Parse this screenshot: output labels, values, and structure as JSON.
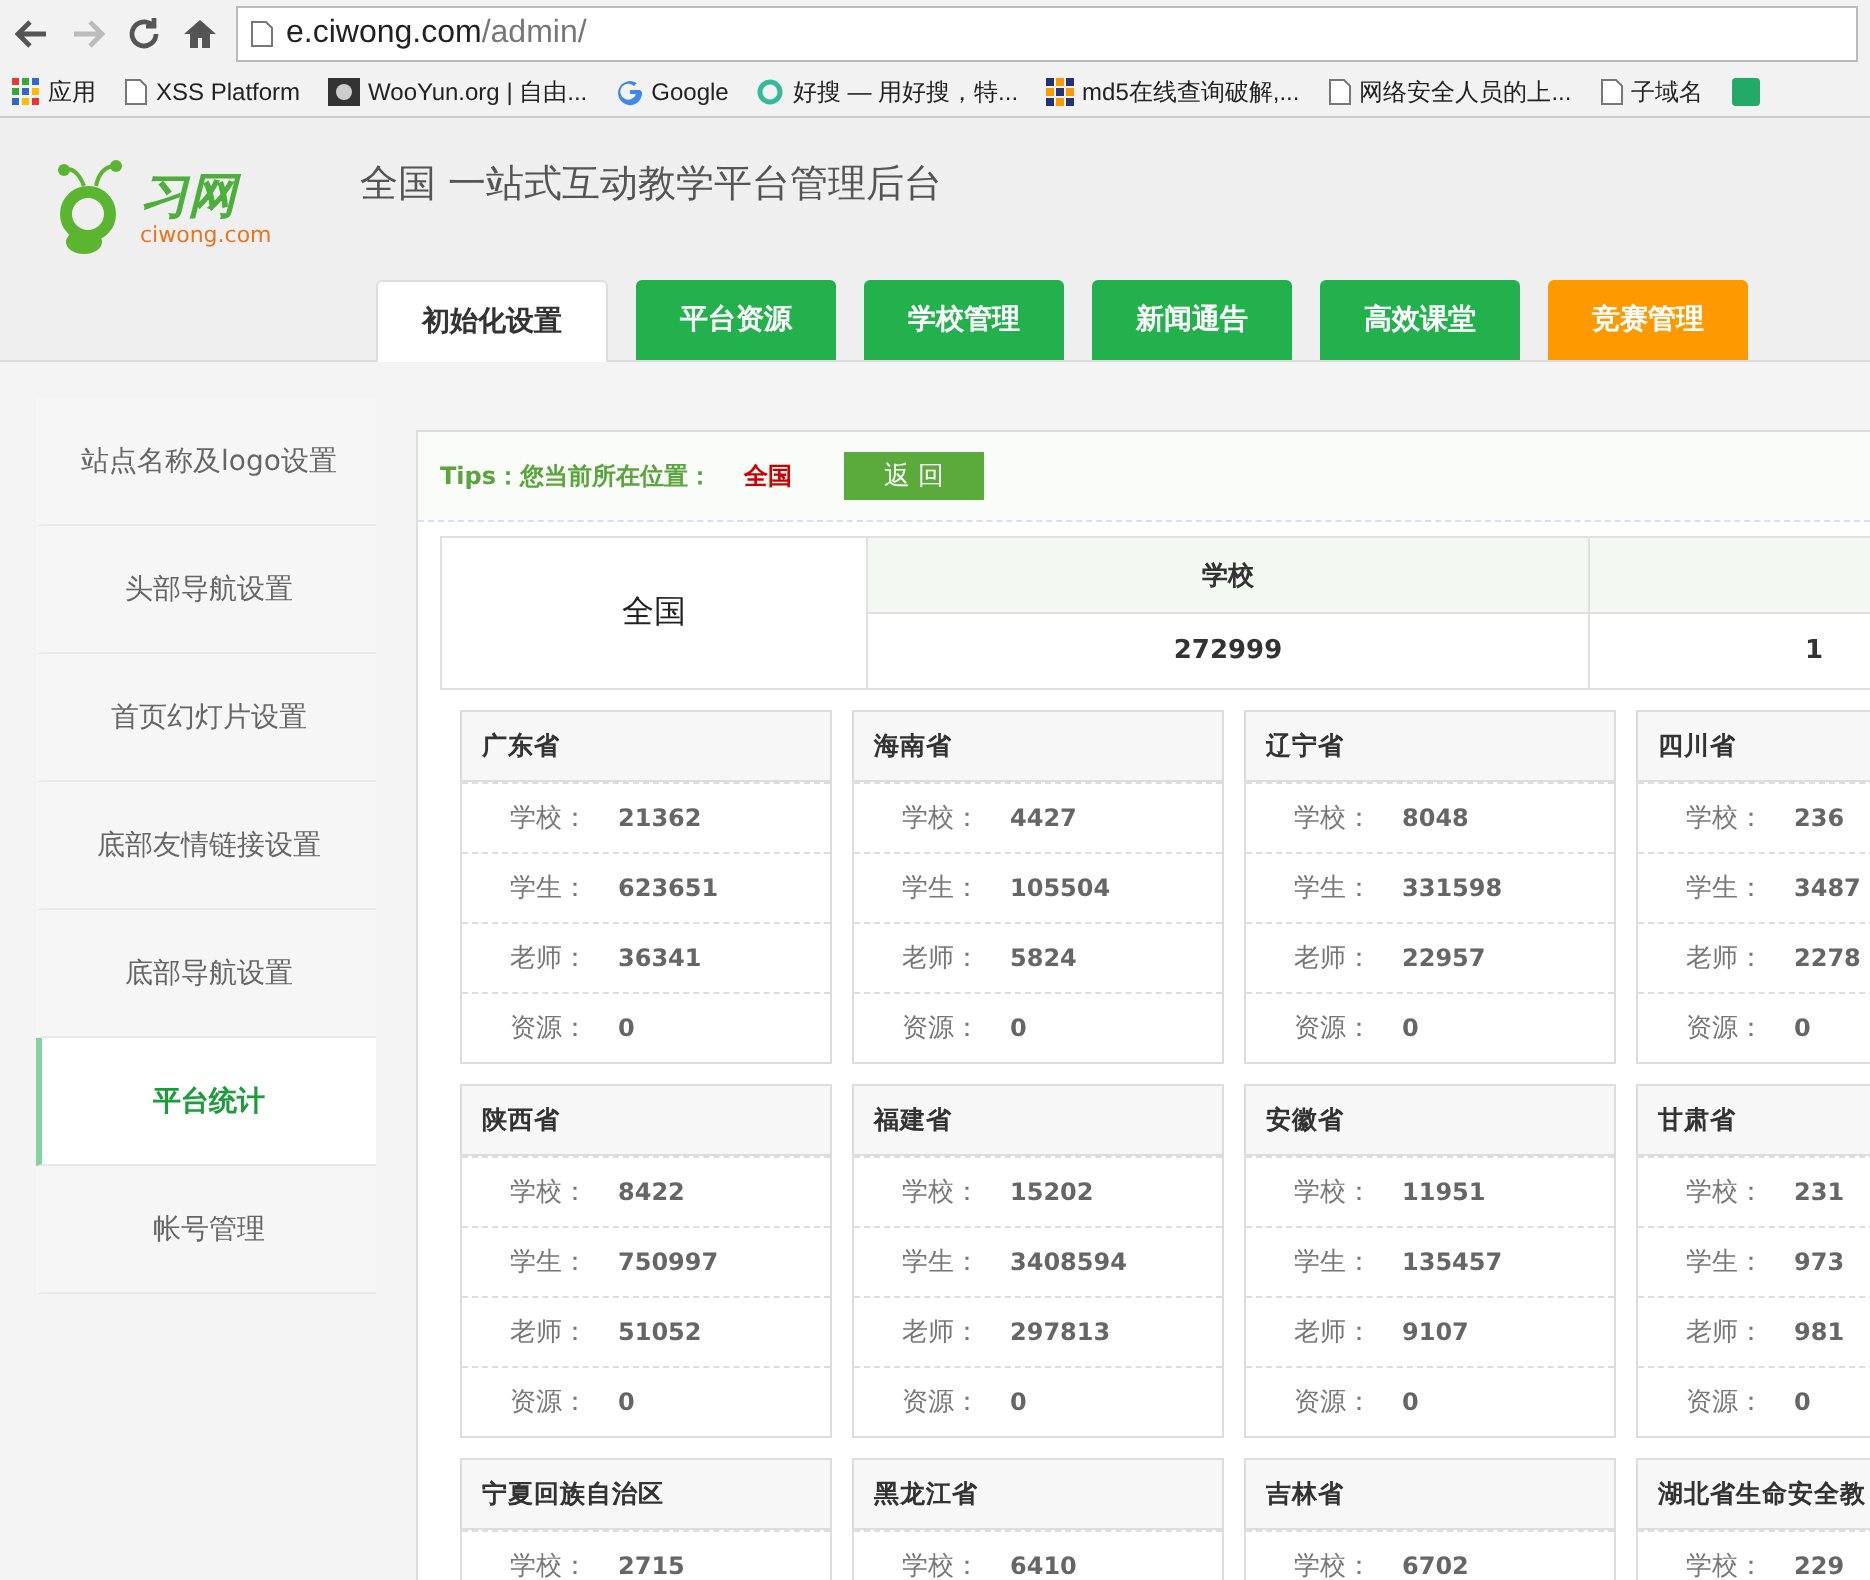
{
  "browser": {
    "url_host": "e.ciwong.com",
    "url_path": "/admin/",
    "bookmarks": [
      {
        "kind": "apps",
        "label": "应用"
      },
      {
        "kind": "page",
        "label": "XSS Platform"
      },
      {
        "kind": "dark",
        "label": "WooYun.org | 自由..."
      },
      {
        "kind": "google",
        "label": "Google"
      },
      {
        "kind": "ring",
        "label": "好搜 — 用好搜，特..."
      },
      {
        "kind": "grid",
        "label": "md5在线查询破解,..."
      },
      {
        "kind": "page",
        "label": "网络安全人员的上..."
      },
      {
        "kind": "page",
        "label": "子域名"
      },
      {
        "kind": "green"
      }
    ]
  },
  "logo": {
    "name": "习网",
    "domain": "ciwong.com"
  },
  "title": "全国 一站式互动教学平台管理后台",
  "tabs": [
    {
      "label": "初始化设置",
      "selected": true,
      "color": "#ffffff"
    },
    {
      "label": "平台资源",
      "selected": false,
      "color": "#22b14c"
    },
    {
      "label": "学校管理",
      "selected": false,
      "color": "#22b14c"
    },
    {
      "label": "新闻通告",
      "selected": false,
      "color": "#22b14c"
    },
    {
      "label": "高效课堂",
      "selected": false,
      "color": "#22b14c"
    },
    {
      "label": "竞赛管理",
      "selected": false,
      "color": "#ff9900"
    }
  ],
  "sidebar": {
    "items": [
      {
        "label": "站点名称及logo设置",
        "selected": false
      },
      {
        "label": "头部导航设置",
        "selected": false
      },
      {
        "label": "首页幻灯片设置",
        "selected": false
      },
      {
        "label": "底部友情链接设置",
        "selected": false
      },
      {
        "label": "底部导航设置",
        "selected": false
      },
      {
        "label": "平台统计",
        "selected": true
      },
      {
        "label": "帐号管理",
        "selected": false
      }
    ]
  },
  "tips": {
    "label": "Tips：您当前所在位置：",
    "location": "全国",
    "back_button": "返 回"
  },
  "summary": {
    "region": "全国",
    "columns": [
      {
        "header": "学校",
        "value": "272999"
      },
      {
        "value": "1"
      }
    ]
  },
  "provinces": [
    {
      "name": "广东省",
      "stats": [
        {
          "label": "学校：",
          "value": "21362"
        },
        {
          "label": "学生：",
          "value": "623651"
        },
        {
          "label": "老师：",
          "value": "36341"
        },
        {
          "label": "资源：",
          "value": "0"
        }
      ]
    },
    {
      "name": "海南省",
      "stats": [
        {
          "label": "学校：",
          "value": "4427"
        },
        {
          "label": "学生：",
          "value": "105504"
        },
        {
          "label": "老师：",
          "value": "5824"
        },
        {
          "label": "资源：",
          "value": "0"
        }
      ]
    },
    {
      "name": "辽宁省",
      "stats": [
        {
          "label": "学校：",
          "value": "8048"
        },
        {
          "label": "学生：",
          "value": "331598"
        },
        {
          "label": "老师：",
          "value": "22957"
        },
        {
          "label": "资源：",
          "value": "0"
        }
      ]
    },
    {
      "name": "四川省",
      "stats": [
        {
          "label": "学校：",
          "value": "236"
        },
        {
          "label": "学生：",
          "value": "3487"
        },
        {
          "label": "老师：",
          "value": "2278"
        },
        {
          "label": "资源：",
          "value": "0"
        }
      ]
    },
    {
      "name": "陕西省",
      "stats": [
        {
          "label": "学校：",
          "value": "8422"
        },
        {
          "label": "学生：",
          "value": "750997"
        },
        {
          "label": "老师：",
          "value": "51052"
        },
        {
          "label": "资源：",
          "value": "0"
        }
      ]
    },
    {
      "name": "福建省",
      "stats": [
        {
          "label": "学校：",
          "value": "15202"
        },
        {
          "label": "学生：",
          "value": "3408594"
        },
        {
          "label": "老师：",
          "value": "297813"
        },
        {
          "label": "资源：",
          "value": "0"
        }
      ]
    },
    {
      "name": "安徽省",
      "stats": [
        {
          "label": "学校：",
          "value": "11951"
        },
        {
          "label": "学生：",
          "value": "135457"
        },
        {
          "label": "老师：",
          "value": "9107"
        },
        {
          "label": "资源：",
          "value": "0"
        }
      ]
    },
    {
      "name": "甘肃省",
      "stats": [
        {
          "label": "学校：",
          "value": "231"
        },
        {
          "label": "学生：",
          "value": "973"
        },
        {
          "label": "老师：",
          "value": "981"
        },
        {
          "label": "资源：",
          "value": "0"
        }
      ]
    },
    {
      "name": "宁夏回族自治区",
      "stats": [
        {
          "label": "学校：",
          "value": "2715"
        }
      ]
    },
    {
      "name": "黑龙江省",
      "stats": [
        {
          "label": "学校：",
          "value": "6410"
        }
      ]
    },
    {
      "name": "吉林省",
      "stats": [
        {
          "label": "学校：",
          "value": "6702"
        }
      ]
    },
    {
      "name": "湖北省生命安全教",
      "stats": [
        {
          "label": "学校：",
          "value": "229"
        }
      ]
    }
  ]
}
